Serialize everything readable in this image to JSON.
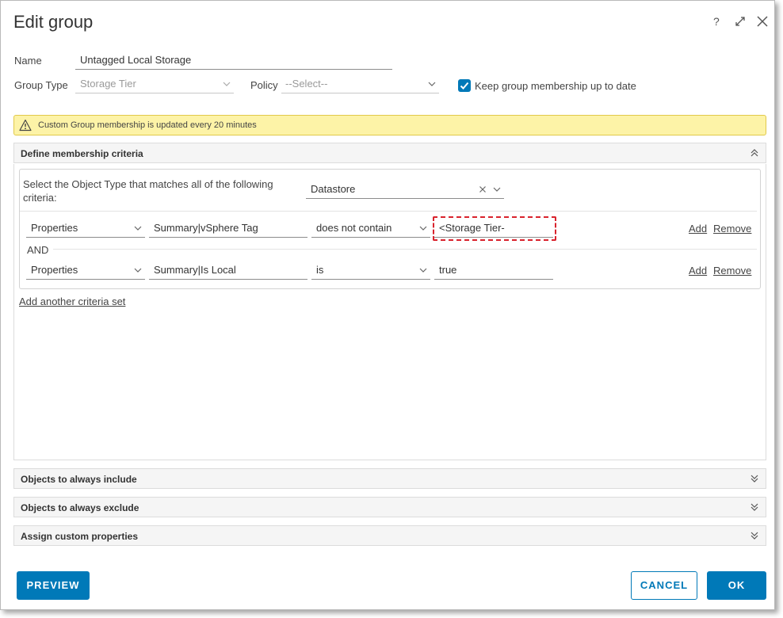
{
  "dialog": {
    "title": "Edit group",
    "help_icon": "help-icon",
    "expand_icon": "expand-icon",
    "close_icon": "close-icon"
  },
  "form": {
    "name_label": "Name",
    "name_value": "Untagged Local Storage",
    "group_type_label": "Group Type",
    "group_type_value": "Storage Tier",
    "policy_label": "Policy",
    "policy_placeholder": "--Select--",
    "keep_membership_label": "Keep group membership up to date",
    "keep_membership_checked": true
  },
  "alert": {
    "icon": "warning-icon",
    "text": "Custom Group membership is updated every 20 minutes"
  },
  "membership": {
    "header": "Define membership criteria",
    "object_type_prompt": "Select the Object Type that matches all of the following criteria:",
    "object_type_value": "Datastore",
    "conjunction": "AND",
    "criteria": [
      {
        "category": "Properties",
        "attribute": "Summary|vSphere Tag",
        "operator": "does not contain",
        "value": "<Storage Tier-",
        "add_label": "Add",
        "remove_label": "Remove"
      },
      {
        "category": "Properties",
        "attribute": "Summary|Is Local",
        "operator": "is",
        "value": "true",
        "add_label": "Add",
        "remove_label": "Remove"
      }
    ],
    "add_criteria_set_label": "Add another criteria set"
  },
  "sections": {
    "include": "Objects to always include",
    "exclude": "Objects to always exclude",
    "custom_props": "Assign custom properties"
  },
  "footer": {
    "preview_label": "PREVIEW",
    "cancel_label": "CANCEL",
    "ok_label": "OK"
  },
  "colors": {
    "accent": "#0079b8",
    "alert_bg": "#fdf3a7",
    "highlight_dashed": "#d9232d"
  }
}
